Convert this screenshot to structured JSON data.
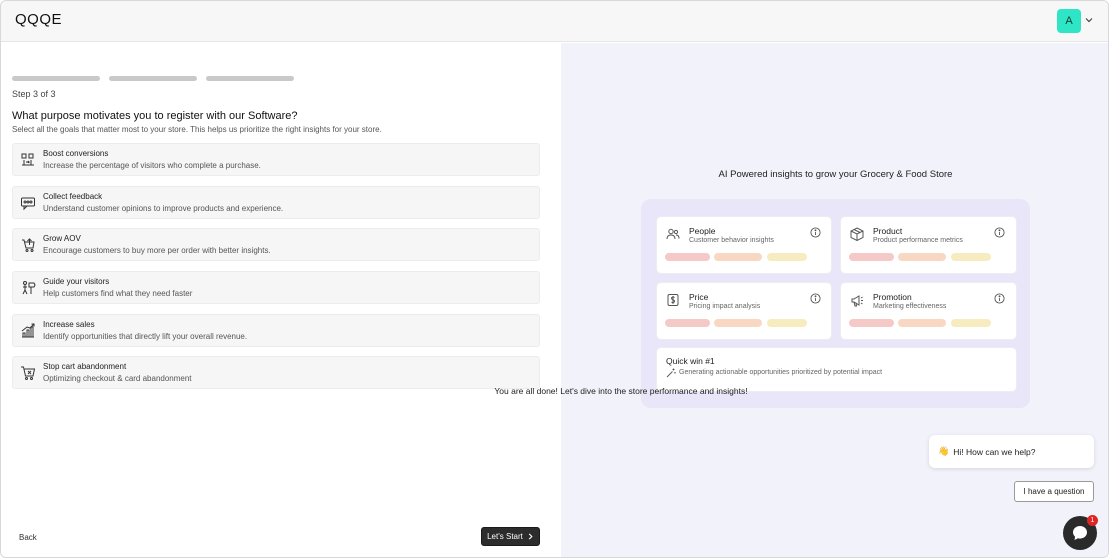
{
  "header": {
    "logo": "QQQE",
    "avatar_initial": "A"
  },
  "onboarding": {
    "progress": [
      1,
      1,
      1
    ],
    "step_label": "Step 3 of 3",
    "question": "What purpose motivates you to register with our Software?",
    "subtitle": "Select all the goals that matter most to your store. This helps us prioritize the right insights for your store.",
    "options": [
      {
        "title": "Boost conversions",
        "desc": "Increase the percentage of visitors who complete a purchase.",
        "icon": "conversion-icon"
      },
      {
        "title": "Collect feedback",
        "desc": "Understand customer opinions to improve products and experience.",
        "icon": "feedback-icon"
      },
      {
        "title": "Grow AOV",
        "desc": "Encourage customers to buy more per order with better insights.",
        "icon": "aov-icon"
      },
      {
        "title": "Guide your visitors",
        "desc": "Help customers find what they need faster",
        "icon": "guide-icon"
      },
      {
        "title": "Increase sales",
        "desc": "Identify opportunities that directly lift your overall revenue.",
        "icon": "sales-chart-icon"
      },
      {
        "title": "Stop cart abandonment",
        "desc": "Optimizing checkout & card abandonment",
        "icon": "cart-icon"
      }
    ],
    "back_label": "Back",
    "start_label": "Let's Start"
  },
  "preview": {
    "title": "AI Powered insights to grow your Grocery & Food Store",
    "cards": [
      {
        "title": "People",
        "sub": "Customer behavior insights",
        "icon": "people-icon"
      },
      {
        "title": "Product",
        "sub": "Product performance metrics",
        "icon": "box-icon"
      },
      {
        "title": "Price",
        "sub": "Pricing impact analysis",
        "icon": "price-tag-icon"
      },
      {
        "title": "Promotion",
        "sub": "Marketing effectiveness",
        "icon": "megaphone-icon"
      }
    ],
    "pill_colors": [
      "#f6c9c9",
      "#f8d8c2",
      "#f7ecbf"
    ],
    "quick_win": {
      "title": "Quick win #1",
      "sub": "Generating actionable opportunities prioritized by potential impact"
    },
    "done_text": "You are all done! Let's dive into the store performance and insights!"
  },
  "chat": {
    "greeting": "Hi! How can we help?",
    "wave": "👋",
    "question_button": "I have a question",
    "unread_count": "1"
  }
}
